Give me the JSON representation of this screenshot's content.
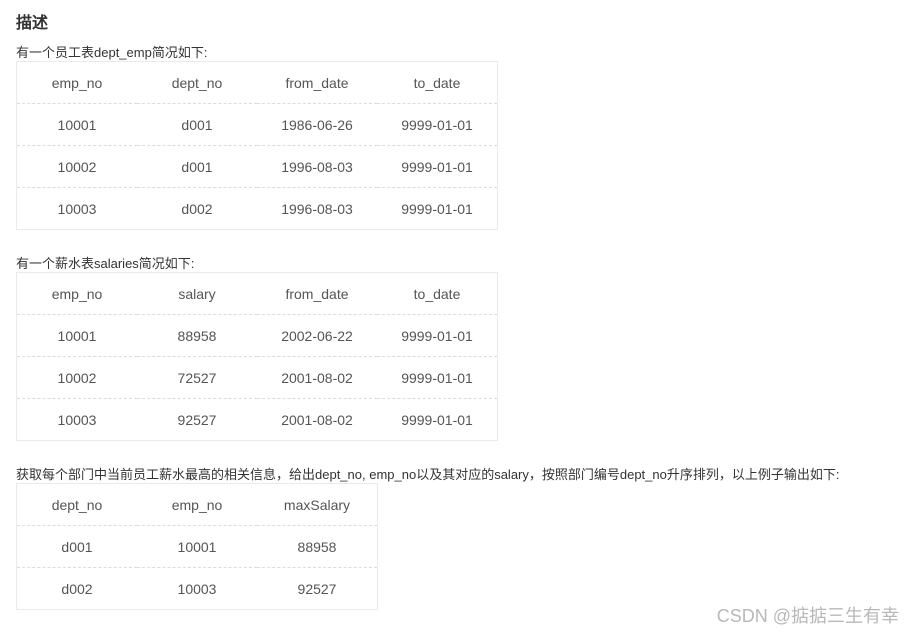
{
  "heading": "描述",
  "dept_emp": {
    "intro": "有一个员工表dept_emp简况如下:",
    "headers": [
      "emp_no",
      "dept_no",
      "from_date",
      "to_date"
    ],
    "rows": [
      [
        "10001",
        "d001",
        "1986-06-26",
        "9999-01-01"
      ],
      [
        "10002",
        "d001",
        "1996-08-03",
        "9999-01-01"
      ],
      [
        "10003",
        "d002",
        "1996-08-03",
        "9999-01-01"
      ]
    ]
  },
  "salaries": {
    "intro": "有一个薪水表salaries简况如下:",
    "headers": [
      "emp_no",
      "salary",
      "from_date",
      "to_date"
    ],
    "rows": [
      [
        "10001",
        "88958",
        "2002-06-22",
        "9999-01-01"
      ],
      [
        "10002",
        "72527",
        "2001-08-02",
        "9999-01-01"
      ],
      [
        "10003",
        "92527",
        "2001-08-02",
        "9999-01-01"
      ]
    ]
  },
  "result": {
    "intro": "获取每个部门中当前员工薪水最高的相关信息，给出dept_no, emp_no以及其对应的salary，按照部门编号dept_no升序排列，以上例子输出如下:",
    "headers": [
      "dept_no",
      "emp_no",
      "maxSalary"
    ],
    "rows": [
      [
        "d001",
        "10001",
        "88958"
      ],
      [
        "d002",
        "10003",
        "92527"
      ]
    ]
  },
  "watermark": "CSDN @掂掂三生有幸"
}
